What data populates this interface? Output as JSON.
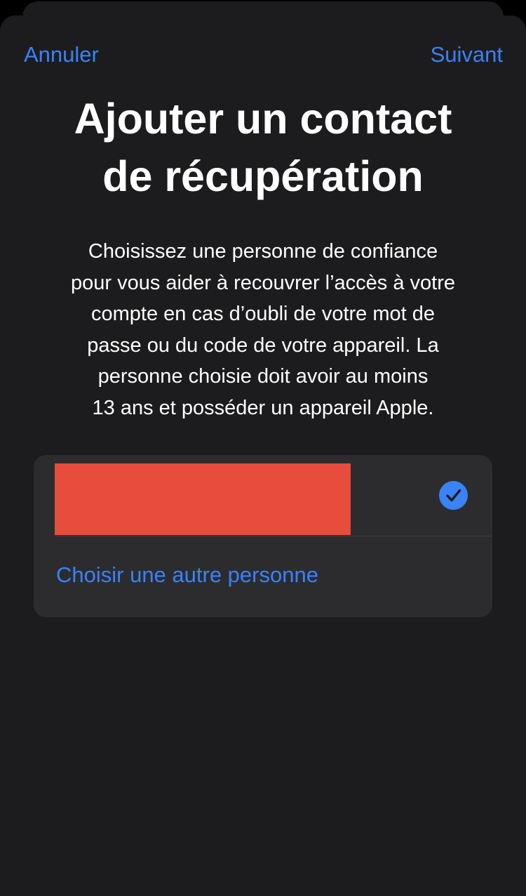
{
  "header": {
    "cancel_label": "Annuler",
    "next_label": "Suivant"
  },
  "main": {
    "title_line1": "Ajouter un contact",
    "title_line2": "de récupération",
    "description_lines": [
      "Choisissez une personne de confiance",
      "pour vous aider à recouvrer l’accès à votre",
      "compte en cas d’oubli de votre mot de",
      "passe ou du code de votre appareil. La",
      "personne choisie doit avoir au moins",
      "13 ans et posséder un appareil Apple."
    ]
  },
  "contacts": {
    "selected_contact": {
      "name_redacted": true,
      "selected": true,
      "icon": "checkmark-circle-icon"
    },
    "choose_other_label": "Choisir une autre personne"
  },
  "colors": {
    "accent": "#3a82f7",
    "background": "#1c1c1e",
    "card": "#2c2c2e",
    "redaction": "#e74c3c"
  }
}
